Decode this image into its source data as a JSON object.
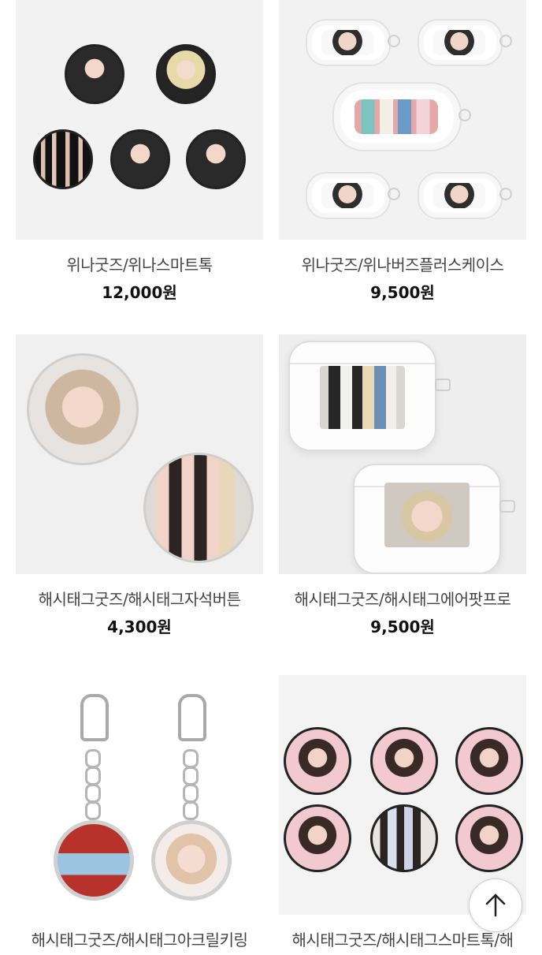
{
  "products": [
    {
      "name": "위나굿즈/위나스마트톡",
      "price": "12,000원"
    },
    {
      "name": "위나굿즈/위나버즈플러스케이스",
      "price": "9,500원"
    },
    {
      "name": "해시태그굿즈/해시태그자석버튼",
      "price": "4,300원"
    },
    {
      "name": "해시태그굿즈/해시태그에어팟프로",
      "price": "9,500원"
    },
    {
      "name": "해시태그굿즈/해시태그아크릴키링",
      "price": ""
    },
    {
      "name": "해시태그굿즈/해시태그스마트톡/해",
      "price": ""
    }
  ],
  "icons": {
    "scroll_top": "arrow-up-icon"
  },
  "colors": {
    "thumb_bg": "#f2f2f2",
    "price": "#111111",
    "name": "#444444"
  }
}
